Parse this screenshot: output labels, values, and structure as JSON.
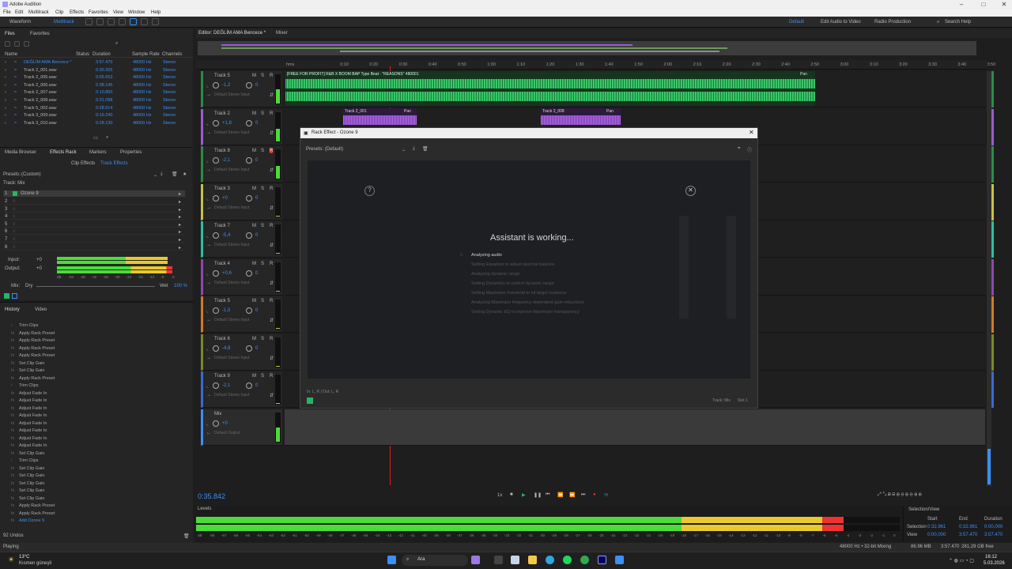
{
  "window": {
    "title": "Adobe Audition"
  },
  "menu": [
    "File",
    "Edit",
    "Multitrack",
    "Clip",
    "Effects",
    "Favorites",
    "View",
    "Window",
    "Help"
  ],
  "toolbar": {
    "waveform": "Waveform",
    "multitrack": "Multitrack",
    "workspaces": [
      "Default",
      "Edit Audio to Video",
      "Radio Production"
    ],
    "search_placeholder": "Search Help"
  },
  "files": {
    "tabs": [
      "Files",
      "Favorites"
    ],
    "columns": [
      "Name",
      "Status",
      "Duration",
      "Sample Rate",
      "Channels"
    ],
    "rows": [
      {
        "name": "DEĞLİM AMA Bencece *",
        "duration": "3:57.470",
        "rate": "48000 Hz",
        "ch": "Stereo",
        "active": true
      },
      {
        "name": "Track 2_001.wav",
        "duration": "0:30.325",
        "rate": "48000 Hz",
        "ch": "Stereo"
      },
      {
        "name": "Track 2_005.wav",
        "duration": "0:05.653",
        "rate": "48000 Hz",
        "ch": "Stereo"
      },
      {
        "name": "Track 2_006.wav",
        "duration": "0:38.145",
        "rate": "48000 Hz",
        "ch": "Stereo"
      },
      {
        "name": "Track 2_007.wav",
        "duration": "0:10.800",
        "rate": "48000 Hz",
        "ch": "Stereo"
      },
      {
        "name": "Track 2_008.wav",
        "duration": "0:31.098",
        "rate": "48000 Hz",
        "ch": "Stereo"
      },
      {
        "name": "Track 5_002.wav",
        "duration": "0:28.514",
        "rate": "48000 Hz",
        "ch": "Stereo"
      },
      {
        "name": "Track 3_009.wav",
        "duration": "0:19.240",
        "rate": "48000 Hz",
        "ch": "Stereo"
      },
      {
        "name": "Track 3_010.wav",
        "duration": "0:28.130",
        "rate": "48000 Hz",
        "ch": "Stereo"
      }
    ]
  },
  "effects_panel": {
    "tabs": [
      "Media Browser",
      "Effects Rack",
      "Markers",
      "Properties"
    ],
    "subtabs": [
      "Clip Effects",
      "Track Effects"
    ],
    "presets_label": "Presets:",
    "presets_value": "(Custom)",
    "track_label": "Track: Mix",
    "slot1": "Ozone 9",
    "slots": [
      "2",
      "3",
      "4",
      "5",
      "6",
      "7",
      "8"
    ],
    "input_label": "Input:",
    "output_label": "Output:",
    "input_val": "+0",
    "output_val": "+0",
    "mix_label": "Mix:",
    "dry": "Dry",
    "wet": "Wet",
    "wet_pct": "100 %",
    "meter_scale": [
      "dB",
      "-54",
      "-48",
      "-42",
      "-36",
      "-30",
      "-24",
      "-18",
      "-12",
      "-6",
      "0"
    ]
  },
  "history": {
    "tabs": [
      "History",
      "Video"
    ],
    "items": [
      "Trim Clips",
      "Apply Rack Preset",
      "Apply Rack Preset",
      "Apply Rack Preset",
      "Apply Rack Preset",
      "Set Clip Gain",
      "Set Clip Gain",
      "Apply Rack Preset",
      "Trim Clips",
      "Adjust Fade In",
      "Adjust Fade In",
      "Adjust Fade In",
      "Adjust Fade In",
      "Adjust Fade In",
      "Adjust Fade In",
      "Adjust Fade In",
      "Adjust Fade In",
      "Set Clip Gain",
      "Trim Clips",
      "Set Clip Gain",
      "Set Clip Gain",
      "Set Clip Gain",
      "Set Clip Gain",
      "Set Clip Gain",
      "Apply Rack Preset",
      "Apply Rack Preset",
      "Add Ozone 9"
    ],
    "undos": "92 Undos"
  },
  "editor": {
    "tab": "Editor: DEĞLİM AMA Bencece *",
    "mixer": "Mixer",
    "ruler": [
      "hms",
      "0:10",
      "0:20",
      "0:30",
      "0:40",
      "0:50",
      "1:00",
      "1:10",
      "1:20",
      "1:30",
      "1:40",
      "1:50",
      "2:00",
      "2:10",
      "2:20",
      "2:30",
      "2:40",
      "2:50",
      "3:00",
      "3:10",
      "3:20",
      "3:30",
      "3:40",
      "3:50"
    ],
    "tracks": [
      {
        "name": "Track 5",
        "vol": "-1,2",
        "pan": "0",
        "input": "Default Stereo Input"
      },
      {
        "name": "Track 2",
        "vol": "+1,8",
        "pan": "0",
        "input": "Default Stereo Input"
      },
      {
        "name": "Track 8",
        "vol": "-2,1",
        "pan": "0",
        "input": "Default Stereo Input"
      },
      {
        "name": "Track 3",
        "vol": "+0",
        "pan": "0",
        "input": "Default Stereo Input"
      },
      {
        "name": "Track 7",
        "vol": "-5,4",
        "pan": "0",
        "input": "Default Stereo Input"
      },
      {
        "name": "Track 4",
        "vol": "+0,6",
        "pan": "0",
        "input": "Default Stereo Input"
      },
      {
        "name": "Track 5",
        "vol": "-1,5",
        "pan": "0",
        "input": "Default Stereo Input"
      },
      {
        "name": "Track 6",
        "vol": "-4,8",
        "pan": "0",
        "input": "Default Stereo Input"
      },
      {
        "name": "Track 9",
        "vol": "-2,1",
        "pan": "0",
        "input": "Default Stereo Input"
      }
    ],
    "mix": {
      "name": "Mix",
      "vol": "+0",
      "input": "Default Output"
    },
    "clip1": "[FREE FOR PROFIT] R&B X BOOM BAP Type Beat - \"REASONS\" 480001",
    "clip_t2a": "Track 2_001",
    "clip_t2b": "Track 2_008",
    "pan_label": "Pan",
    "time": "0:35.842",
    "zoom": "1x"
  },
  "dialog": {
    "title": "Rack Effect - Ozone 9",
    "presets_label": "Presets:",
    "presets_value": "(Default)",
    "assistant_title": "Assistant is working...",
    "steps": [
      "Analyzing audio",
      "Setting Equalizer to adjust spectral balance",
      "Analyzing dynamic range",
      "Setting Dynamics to control dynamic range",
      "Setting Maximizer threshold to hit target loudness",
      "Analyzing Maximizer frequency-dependent gain reductions",
      "Setting Dynamic EQ to improve Maximizer transparency"
    ],
    "io": "In: L, R | Out: L, R",
    "track": "Track: Mix",
    "slot": "Slot 1"
  },
  "levels": {
    "tab": "Levels",
    "scale": [
      "dB",
      "-59",
      "-57",
      "-56",
      "-55",
      "-54",
      "-53",
      "-52",
      "-51",
      "-50",
      "-49",
      "-48",
      "-47",
      "-46",
      "-45",
      "-44",
      "-43",
      "-42",
      "-41",
      "-40",
      "-39",
      "-38",
      "-37",
      "-36",
      "-35",
      "-34",
      "-33",
      "-32",
      "-31",
      "-30",
      "-29",
      "-28",
      "-27",
      "-26",
      "-25",
      "-24",
      "-23",
      "-22",
      "-21",
      "-20",
      "-19",
      "-18",
      "-17",
      "-16",
      "-15",
      "-14",
      "-13",
      "-12",
      "-11",
      "-10",
      "-9",
      "-8",
      "-7",
      "-6",
      "-5",
      "-4",
      "-3",
      "-2",
      "-1",
      "0"
    ]
  },
  "selection": {
    "tab": "Selection/View",
    "cols": [
      "Start",
      "End",
      "Duration"
    ],
    "sel_label": "Selection",
    "view_label": "View",
    "sel": [
      "0:32.961",
      "0:32.961",
      "0:00.000"
    ],
    "view": [
      "0:00.000",
      "3:57.470",
      "3:57.470"
    ]
  },
  "status": {
    "left": "Playing",
    "fmt": "48000 Hz • 32-bit Mixing",
    "mem": "86.96 MB",
    "dur": "3:57.470",
    "free": "281,29 GB free"
  },
  "taskbar": {
    "weather_temp": "13°C",
    "weather_desc": "Kısmen güneşli",
    "search": "Ara",
    "time": "16:12",
    "date": "5.03.2026"
  }
}
